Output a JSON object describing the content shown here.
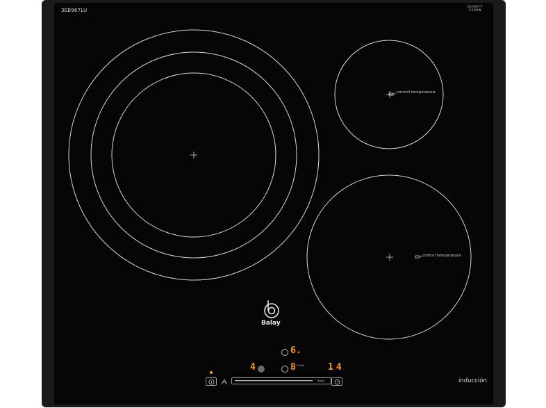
{
  "product": {
    "model": "3EB967LU",
    "glass_brand": "SCHOTT\nCERAN",
    "glass_brand_line1": "SCHOTT",
    "glass_brand_line2": "CERAN",
    "glass_sub": "",
    "brand": "Balay",
    "type_label": "inducción"
  },
  "zones": {
    "top_right_label": "control temperatura",
    "bottom_right_label": "control temperatura"
  },
  "display": {
    "top_digit": "6.",
    "left_digit": "4",
    "center_digit": "8",
    "timer_digits": "14",
    "combi_label": "Combi",
    "boost_label": "Boost"
  },
  "colors": {
    "glass": "#050505",
    "frame": "#1a1a1a",
    "display": "#ff9a1a",
    "lines": "#d8d8d8"
  },
  "icons": {
    "info": "info-icon",
    "wipe_protect": "wipe-protect-icon",
    "timer": "timer-icon",
    "logo": "balay-logo-icon"
  }
}
